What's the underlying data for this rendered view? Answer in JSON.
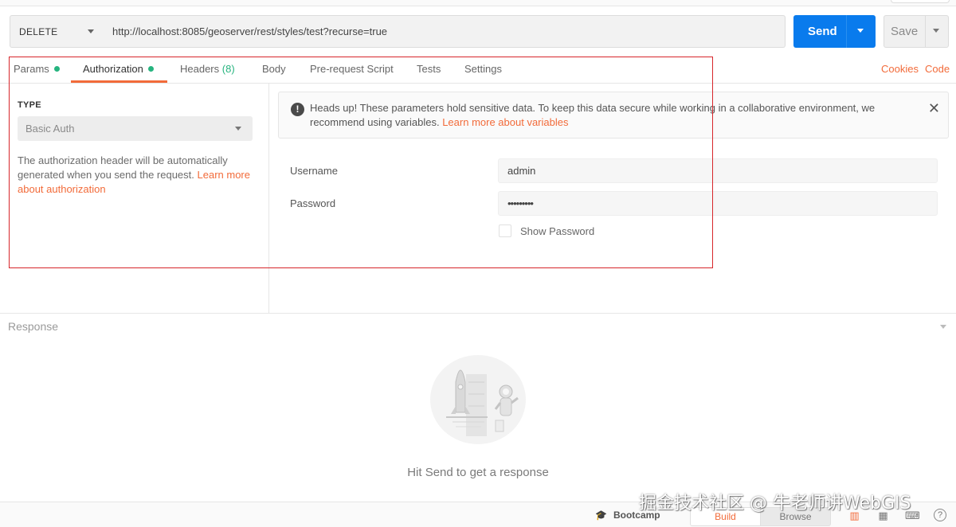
{
  "request": {
    "method": "DELETE",
    "url": "http://localhost:8085/geoserver/rest/styles/test?recurse=true",
    "send_label": "Send",
    "save_label": "Save"
  },
  "tabs": [
    {
      "label": "Params",
      "dot": true
    },
    {
      "label": "Authorization",
      "dot": true,
      "active": true
    },
    {
      "label": "Headers",
      "count": "(8)"
    },
    {
      "label": "Body"
    },
    {
      "label": "Pre-request Script"
    },
    {
      "label": "Tests"
    },
    {
      "label": "Settings"
    }
  ],
  "right_links": {
    "cookies": "Cookies",
    "code": "Code"
  },
  "auth": {
    "type_label": "TYPE",
    "type_value": "Basic Auth",
    "help_text": "The authorization header will be automatically generated when you send the request. ",
    "help_link": "Learn more about authorization"
  },
  "alert": {
    "text": "Heads up! These parameters hold sensitive data. To keep this data secure while working in a collaborative environment, we recommend using variables. ",
    "link": "Learn more about variables",
    "icon": "info-icon"
  },
  "form": {
    "username_label": "Username",
    "username_value": "admin",
    "password_label": "Password",
    "password_value": "•••••••••",
    "show_password_label": "Show Password"
  },
  "response": {
    "title": "Response",
    "hint": "Hit Send to get a response"
  },
  "footer": {
    "bootcamp": "Bootcamp",
    "build": "Build",
    "browse": "Browse"
  },
  "watermark": "掘金技术社区 @ 牛老师讲WebGIS",
  "colors": {
    "accent": "#f26b3a",
    "send_blue": "#097bed",
    "status_green": "#26b47f",
    "annotation_red": "#d7262b"
  }
}
